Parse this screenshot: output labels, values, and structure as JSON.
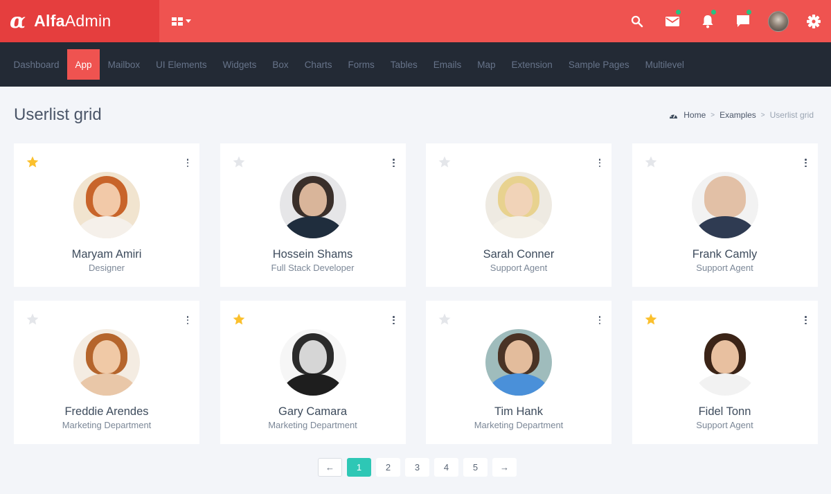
{
  "brand": {
    "logo_glyph": "α",
    "name_bold": "Alfa",
    "name_light": "Admin"
  },
  "topbar": {
    "apps_icon": "apps-grid-icon",
    "icons": [
      {
        "name": "search-icon",
        "has_dot": false
      },
      {
        "name": "mail-icon",
        "has_dot": true
      },
      {
        "name": "bell-icon",
        "has_dot": true
      },
      {
        "name": "chat-icon",
        "has_dot": true
      },
      {
        "name": "user-avatar",
        "has_dot": false
      },
      {
        "name": "gear-icon",
        "has_dot": false
      }
    ],
    "dot_color": "#26c281"
  },
  "nav": {
    "items": [
      {
        "label": "Dashboard",
        "active": false
      },
      {
        "label": "App",
        "active": true
      },
      {
        "label": "Mailbox",
        "active": false
      },
      {
        "label": "UI Elements",
        "active": false
      },
      {
        "label": "Widgets",
        "active": false
      },
      {
        "label": "Box",
        "active": false
      },
      {
        "label": "Charts",
        "active": false
      },
      {
        "label": "Forms",
        "active": false
      },
      {
        "label": "Tables",
        "active": false
      },
      {
        "label": "Emails",
        "active": false
      },
      {
        "label": "Map",
        "active": false
      },
      {
        "label": "Extension",
        "active": false
      },
      {
        "label": "Sample Pages",
        "active": false
      },
      {
        "label": "Multilevel",
        "active": false
      }
    ]
  },
  "page": {
    "title": "Userlist grid",
    "breadcrumb": {
      "home": "Home",
      "section": "Examples",
      "current": "Userlist grid",
      "separator": ">"
    }
  },
  "users": [
    {
      "name": "Maryam Amiri",
      "role": "Designer",
      "starred": true
    },
    {
      "name": "Hossein Shams",
      "role": "Full Stack Developer",
      "starred": false
    },
    {
      "name": "Sarah Conner",
      "role": "Support Agent",
      "starred": false
    },
    {
      "name": "Frank Camly",
      "role": "Support Agent",
      "starred": false
    },
    {
      "name": "Freddie Arendes",
      "role": "Marketing Department",
      "starred": false
    },
    {
      "name": "Gary Camara",
      "role": "Marketing Department",
      "starred": true
    },
    {
      "name": "Tim Hank",
      "role": "Marketing Department",
      "starred": false
    },
    {
      "name": "Fidel Tonn",
      "role": "Support Agent",
      "starred": true
    }
  ],
  "pagination": {
    "prev": "←",
    "pages": [
      "1",
      "2",
      "3",
      "4",
      "5"
    ],
    "current": "1",
    "next": "→"
  },
  "colors": {
    "primary": "#ef5350",
    "brand_bg": "#e53e3e",
    "nav_bg": "#232a35",
    "star_on": "#fbc02d",
    "star_off": "#e4e6ea",
    "pager_active": "#2ec7b5"
  }
}
